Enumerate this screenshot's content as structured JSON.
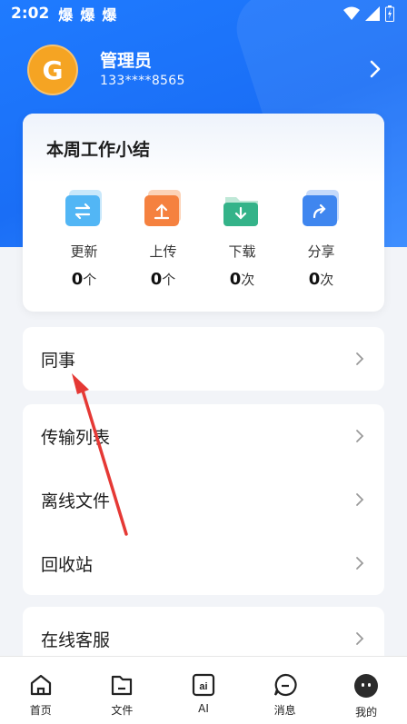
{
  "status_bar": {
    "time": "2:02",
    "notifications": [
      "爆",
      "爆",
      "爆"
    ]
  },
  "profile": {
    "avatar_letter": "G",
    "name": "管理员",
    "phone": "133****8565"
  },
  "summary": {
    "title": "本周工作小结",
    "stats": [
      {
        "label": "更新",
        "value": "0",
        "unit": "个",
        "icon": "swap-icon",
        "color": "#52b6f5"
      },
      {
        "label": "上传",
        "value": "0",
        "unit": "个",
        "icon": "upload-icon",
        "color": "#f5813f"
      },
      {
        "label": "下载",
        "value": "0",
        "unit": "次",
        "icon": "download-icon",
        "color": "#34b389"
      },
      {
        "label": "分享",
        "value": "0",
        "unit": "次",
        "icon": "share-icon",
        "color": "#3f86ef"
      }
    ]
  },
  "menu": {
    "colleagues": "同事",
    "transfer_list": "传输列表",
    "offline_files": "离线文件",
    "recycle_bin": "回收站",
    "online_service": "在线客服"
  },
  "tabbar": {
    "tabs": [
      {
        "label": "首页",
        "icon": "home-icon"
      },
      {
        "label": "文件",
        "icon": "folder-icon"
      },
      {
        "label": "AI",
        "icon": "ai-icon"
      },
      {
        "label": "消息",
        "icon": "message-icon"
      },
      {
        "label": "我的",
        "icon": "profile-icon",
        "active": true
      }
    ]
  },
  "colors": {
    "primary": "#1f7bff",
    "avatar": "#f5a423",
    "annotation": "#e53935"
  }
}
